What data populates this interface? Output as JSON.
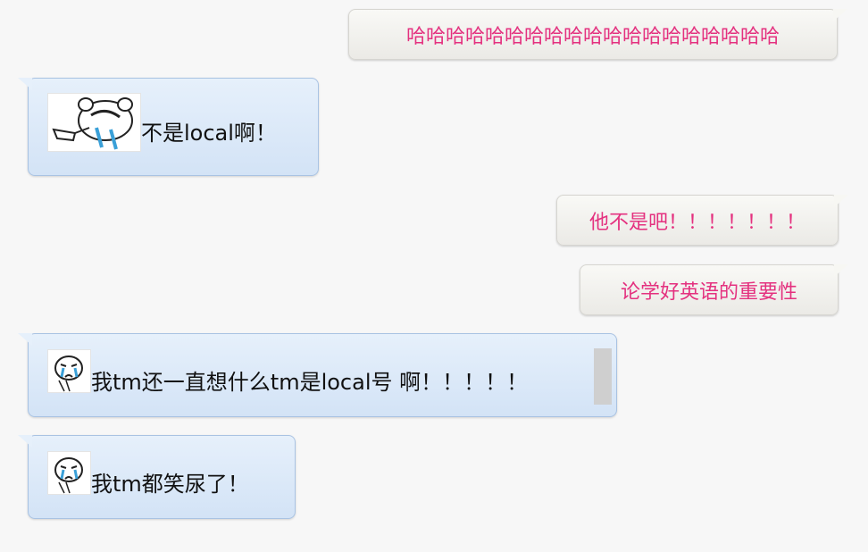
{
  "conversation": {
    "messages": [
      {
        "side": "right",
        "text": "哈哈哈哈哈哈哈哈哈哈哈哈哈哈哈哈哈哈哈"
      },
      {
        "side": "left",
        "text": "不是local啊！",
        "emoji": "facepalm-bear-sticker"
      },
      {
        "side": "right",
        "text": "他不是吧！！！！！！！"
      },
      {
        "side": "right",
        "text": "论学好英语的重要性"
      },
      {
        "side": "left",
        "text": "我tm还一直想什么tm是local号 啊！！！！！",
        "emoji": "crying-face-sticker"
      },
      {
        "side": "left",
        "text": "我tm都笑尿了！",
        "emoji": "crying-face-sticker"
      }
    ]
  },
  "colors": {
    "right_text": "#e4317f",
    "left_bubble": "#d9e7f8",
    "right_bubble": "#f0efeb",
    "background": "#f7f7f7"
  }
}
